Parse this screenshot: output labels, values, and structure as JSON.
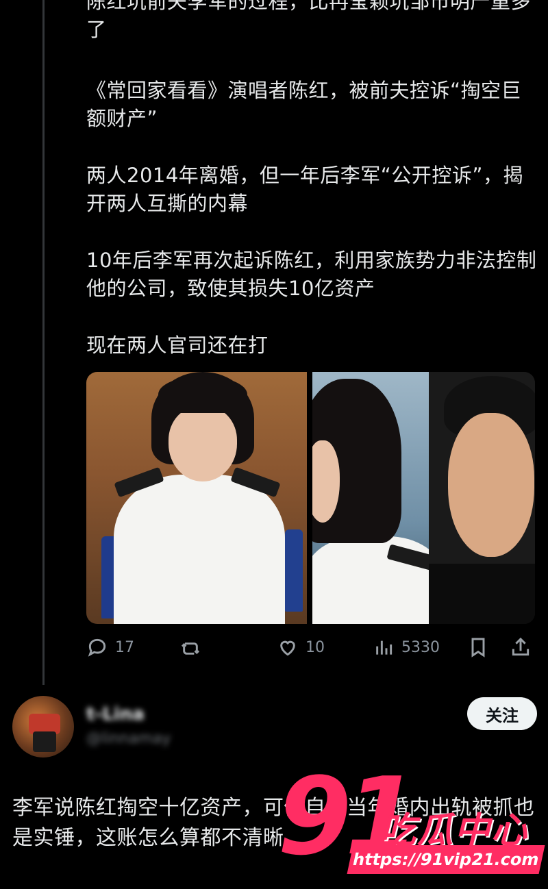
{
  "post": {
    "paragraphs": [
      "陈红坑前夫李军的过程，比冉莹颖坑邹市明严重多了",
      "《常回家看看》演唱者陈红，被前夫控诉“掏空巨额财产”",
      "两人2014年离婚，但一年后李军“公开控诉”，揭开两人互撕的内幕",
      "10年后李军再次起诉陈红，利用家族势力非法控制他的公司，致使其损失10亿资产",
      "现在两人官司还在打"
    ],
    "actions": {
      "replies": "17",
      "retweets": "",
      "likes": "10",
      "views": "5330"
    }
  },
  "reply": {
    "display_name": "t-Lina",
    "handle": "@linnamay",
    "follow_label": "关注",
    "text": "李军说陈红掏空十亿资产，可他自己当年婚内出轨被抓也是实锤，这账怎么算都不清晰"
  },
  "watermark": {
    "brand_number": "91",
    "brand_title": "吃瓜中心",
    "url": "https://91vip21.com"
  },
  "colors": {
    "background": "#000000",
    "text": "#e7e9ea",
    "muted": "#8b949e",
    "watermark": "#ff2d63"
  }
}
